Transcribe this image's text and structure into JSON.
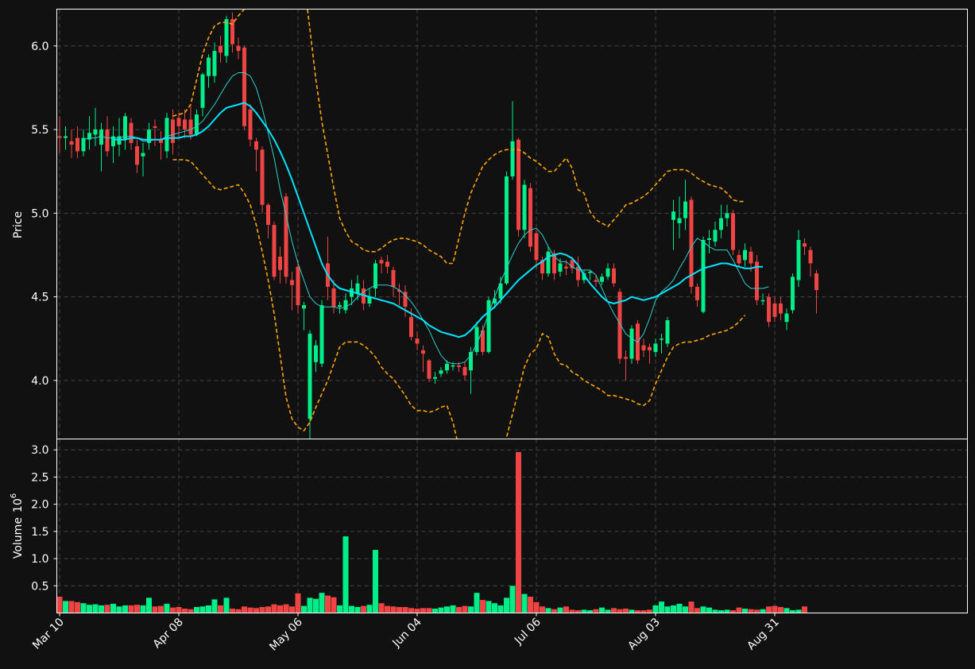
{
  "chart_data": {
    "type": "candlestick",
    "panels": [
      "price",
      "volume"
    ],
    "price_panel": {
      "ylabel": "Price",
      "ylim": [
        3.65,
        6.22
      ],
      "yticks": [
        4.0,
        4.5,
        5.0,
        5.5,
        6.0
      ],
      "ytick_labels": [
        "4.0",
        "4.5",
        "5.0",
        "5.5",
        "6.0"
      ]
    },
    "volume_panel": {
      "ylabel": "Volume",
      "ylabel_multiplier": "10",
      "ylabel_exponent": "6",
      "ylim": [
        0,
        3.2
      ],
      "yticks": [
        0.5,
        1.0,
        1.5,
        2.0,
        2.5,
        3.0
      ],
      "ytick_labels": [
        "0.5",
        "1.0",
        "1.5",
        "2.0",
        "2.5",
        "3.0"
      ]
    },
    "xtick_labels": [
      "Mar 10",
      "Apr 08",
      "May 06",
      "Jun 04",
      "Jul 06",
      "Aug 03",
      "Aug 31"
    ],
    "xtick_indices": [
      0,
      20,
      40,
      60,
      80,
      100,
      120
    ],
    "grid": true,
    "colors": {
      "background": "#111111",
      "up": "#00ee88",
      "down": "#ee4444",
      "ma_fast": "#30d0d0",
      "ma_slow": "#00e5ff",
      "bands": "#ffa500",
      "grid": "#444444",
      "text": "#ffffff"
    },
    "candles": [
      [
        5.46,
        5.45,
        5.58,
        5.36
      ],
      [
        5.45,
        5.46,
        5.52,
        5.38
      ],
      [
        5.43,
        5.41,
        5.5,
        5.33
      ],
      [
        5.45,
        5.37,
        5.52,
        5.33
      ],
      [
        5.37,
        5.45,
        5.5,
        5.34
      ],
      [
        5.44,
        5.48,
        5.58,
        5.38
      ],
      [
        5.47,
        5.5,
        5.63,
        5.4
      ],
      [
        5.41,
        5.5,
        5.54,
        5.25
      ],
      [
        5.5,
        5.37,
        5.58,
        5.34
      ],
      [
        5.4,
        5.46,
        5.52,
        5.3
      ],
      [
        5.41,
        5.46,
        5.57,
        5.34
      ],
      [
        5.44,
        5.58,
        5.6,
        5.38
      ],
      [
        5.54,
        5.42,
        5.57,
        5.38
      ],
      [
        5.4,
        5.29,
        5.44,
        5.24
      ],
      [
        5.34,
        5.36,
        5.42,
        5.22
      ],
      [
        5.42,
        5.5,
        5.54,
        5.38
      ],
      [
        5.52,
        5.51,
        5.56,
        5.4
      ],
      [
        5.44,
        5.42,
        5.49,
        5.32
      ],
      [
        5.37,
        5.57,
        5.6,
        5.33
      ],
      [
        5.56,
        5.42,
        5.62,
        5.35
      ],
      [
        5.57,
        5.52,
        5.6,
        5.45
      ],
      [
        5.56,
        5.5,
        5.62,
        5.45
      ],
      [
        5.56,
        5.47,
        5.64,
        5.44
      ],
      [
        5.47,
        5.59,
        5.62,
        5.46
      ],
      [
        5.63,
        5.83,
        5.84,
        5.58
      ],
      [
        5.82,
        5.93,
        5.95,
        5.75
      ],
      [
        5.82,
        5.97,
        6.02,
        5.78
      ],
      [
        6.0,
        5.96,
        6.06,
        5.9
      ],
      [
        5.94,
        6.16,
        6.18,
        5.9
      ],
      [
        6.16,
        6.01,
        6.2,
        5.96
      ],
      [
        6.0,
        5.97,
        6.05,
        5.92
      ],
      [
        5.99,
        5.52,
        6.0,
        5.5
      ],
      [
        5.62,
        5.44,
        5.65,
        5.4
      ],
      [
        5.43,
        5.38,
        5.45,
        5.25
      ],
      [
        5.38,
        5.05,
        5.4,
        5.0
      ],
      [
        5.05,
        4.93,
        5.06,
        4.85
      ],
      [
        4.93,
        4.62,
        4.95,
        4.6
      ],
      [
        4.74,
        4.66,
        4.8,
        4.58
      ],
      [
        5.1,
        4.62,
        5.12,
        4.58
      ],
      [
        4.6,
        4.57,
        4.65,
        4.42
      ],
      [
        4.68,
        4.45,
        4.72,
        4.4
      ],
      [
        4.43,
        4.45,
        4.47,
        4.3
      ],
      [
        3.77,
        4.28,
        4.3,
        3.62
      ],
      [
        4.11,
        4.21,
        4.24,
        4.05
      ],
      [
        4.1,
        4.45,
        4.48,
        4.08
      ],
      [
        4.7,
        4.56,
        4.86,
        4.48
      ],
      [
        4.55,
        4.44,
        4.6,
        4.4
      ],
      [
        4.44,
        4.45,
        4.47,
        4.4
      ],
      [
        4.42,
        4.48,
        4.52,
        4.4
      ],
      [
        4.5,
        4.55,
        4.6,
        4.45
      ],
      [
        4.52,
        4.58,
        4.63,
        4.48
      ],
      [
        4.55,
        4.46,
        4.6,
        4.42
      ],
      [
        4.46,
        4.5,
        4.55,
        4.44
      ],
      [
        4.55,
        4.7,
        4.72,
        4.5
      ],
      [
        4.72,
        4.7,
        4.74,
        4.64
      ],
      [
        4.71,
        4.68,
        4.75,
        4.64
      ],
      [
        4.66,
        4.56,
        4.68,
        4.5
      ],
      [
        4.54,
        4.53,
        4.58,
        4.45
      ],
      [
        4.53,
        4.44,
        4.57,
        4.38
      ],
      [
        4.38,
        4.26,
        4.43,
        4.24
      ],
      [
        4.25,
        4.22,
        4.29,
        4.18
      ],
      [
        4.18,
        4.16,
        4.21,
        4.05
      ],
      [
        4.12,
        4.01,
        4.13,
        3.99
      ],
      [
        4.01,
        4.02,
        4.05,
        3.98
      ],
      [
        4.04,
        4.06,
        4.08,
        4.02
      ],
      [
        4.06,
        4.1,
        4.12,
        4.04
      ],
      [
        4.09,
        4.09,
        4.11,
        4.06
      ],
      [
        4.09,
        4.08,
        4.11,
        4.05
      ],
      [
        4.08,
        4.03,
        4.11,
        4.0
      ],
      [
        4.06,
        4.17,
        4.2,
        3.92
      ],
      [
        4.17,
        4.32,
        4.35,
        4.15
      ],
      [
        4.3,
        4.17,
        4.33,
        4.15
      ],
      [
        4.17,
        4.48,
        4.5,
        4.16
      ],
      [
        4.46,
        4.49,
        4.54,
        4.43
      ],
      [
        4.49,
        4.58,
        4.62,
        4.46
      ],
      [
        4.58,
        5.22,
        5.25,
        4.57
      ],
      [
        5.22,
        5.43,
        5.67,
        5.2
      ],
      [
        5.44,
        4.9,
        5.45,
        4.86
      ],
      [
        4.9,
        5.17,
        5.2,
        4.85
      ],
      [
        5.15,
        4.8,
        5.18,
        4.77
      ],
      [
        4.88,
        4.72,
        4.9,
        4.67
      ],
      [
        4.72,
        4.64,
        4.74,
        4.6
      ],
      [
        4.64,
        4.77,
        4.8,
        4.62
      ],
      [
        4.76,
        4.64,
        4.78,
        4.6
      ],
      [
        4.65,
        4.7,
        4.73,
        4.62
      ],
      [
        4.68,
        4.67,
        4.72,
        4.63
      ],
      [
        4.72,
        4.67,
        4.74,
        4.64
      ],
      [
        4.68,
        4.6,
        4.74,
        4.56
      ],
      [
        4.6,
        4.64,
        4.66,
        4.58
      ],
      [
        4.65,
        4.65,
        4.66,
        4.6
      ],
      [
        4.6,
        4.59,
        4.63,
        4.56
      ],
      [
        4.59,
        4.62,
        4.64,
        4.57
      ],
      [
        4.62,
        4.67,
        4.7,
        4.6
      ],
      [
        4.67,
        4.58,
        4.7,
        4.56
      ],
      [
        4.53,
        4.13,
        4.55,
        4.1
      ],
      [
        4.14,
        4.13,
        4.18,
        4.0
      ],
      [
        4.13,
        4.31,
        4.33,
        4.1
      ],
      [
        4.34,
        4.12,
        4.36,
        4.1
      ],
      [
        4.21,
        4.18,
        4.25,
        4.14
      ],
      [
        4.2,
        4.18,
        4.22,
        4.1
      ],
      [
        4.17,
        4.22,
        4.25,
        4.14
      ],
      [
        4.25,
        4.25,
        4.28,
        4.16
      ],
      [
        4.22,
        4.36,
        4.38,
        4.2
      ],
      [
        4.96,
        5.01,
        5.08,
        4.78
      ],
      [
        4.94,
        4.97,
        5.1,
        4.85
      ],
      [
        4.97,
        5.07,
        5.2,
        4.9
      ],
      [
        5.08,
        4.56,
        5.1,
        4.52
      ],
      [
        4.56,
        4.48,
        4.58,
        4.44
      ],
      [
        4.41,
        4.84,
        4.86,
        4.4
      ],
      [
        4.84,
        4.85,
        4.9,
        4.76
      ],
      [
        4.83,
        4.9,
        4.95,
        4.8
      ],
      [
        4.9,
        4.97,
        5.05,
        4.85
      ],
      [
        4.97,
        5.0,
        5.05,
        4.92
      ],
      [
        5.0,
        4.78,
        5.02,
        4.75
      ],
      [
        4.75,
        4.7,
        4.78,
        4.68
      ],
      [
        4.72,
        4.78,
        4.82,
        4.68
      ],
      [
        4.77,
        4.7,
        4.8,
        4.65
      ],
      [
        4.71,
        4.48,
        4.75,
        4.45
      ],
      [
        4.48,
        4.48,
        4.52,
        4.45
      ],
      [
        4.5,
        4.35,
        4.52,
        4.32
      ],
      [
        4.46,
        4.38,
        4.5,
        4.35
      ],
      [
        4.46,
        4.4,
        4.5,
        4.36
      ],
      [
        4.35,
        4.4,
        4.43,
        4.3
      ],
      [
        4.42,
        4.62,
        4.64,
        4.4
      ],
      [
        4.6,
        4.84,
        4.9,
        4.56
      ],
      [
        4.82,
        4.8,
        4.85,
        4.75
      ],
      [
        4.78,
        4.7,
        4.8,
        4.62
      ],
      [
        4.64,
        4.54,
        4.66,
        4.4
      ]
    ],
    "ma_fast": [
      null,
      null,
      null,
      null,
      5.44,
      5.45,
      5.45,
      5.46,
      5.45,
      5.45,
      5.45,
      5.46,
      5.46,
      5.45,
      5.43,
      5.43,
      5.44,
      5.44,
      5.46,
      5.47,
      5.48,
      5.49,
      5.5,
      5.52,
      5.55,
      5.6,
      5.65,
      5.71,
      5.77,
      5.82,
      5.84,
      5.84,
      5.82,
      5.75,
      5.63,
      5.48,
      5.33,
      5.14,
      4.99,
      4.83,
      4.7,
      4.6,
      4.5,
      4.46,
      4.44,
      4.44,
      4.44,
      4.43,
      4.44,
      4.46,
      4.5,
      4.53,
      4.55,
      4.57,
      4.57,
      4.57,
      4.56,
      4.54,
      4.51,
      4.47,
      4.42,
      4.36,
      4.3,
      4.22,
      4.15,
      4.11,
      4.1,
      4.1,
      4.11,
      4.15,
      4.22,
      4.3,
      4.4,
      4.5,
      4.59,
      4.67,
      4.75,
      4.82,
      4.87,
      4.9,
      4.91,
      4.87,
      4.8,
      4.74,
      4.71,
      4.71,
      4.68,
      4.66,
      4.66,
      4.66,
      4.63,
      4.55,
      4.47,
      4.4,
      4.34,
      4.28,
      4.25,
      4.23,
      4.28,
      4.37,
      4.48,
      4.53,
      4.56,
      4.6,
      4.67,
      4.73,
      4.8,
      4.85,
      4.83,
      4.8,
      4.78,
      4.78,
      4.78,
      4.72,
      4.65,
      4.58,
      4.55,
      4.55,
      4.55,
      4.56
    ],
    "ma_slow": [
      null,
      null,
      null,
      null,
      null,
      null,
      null,
      null,
      null,
      5.44,
      5.44,
      5.44,
      5.45,
      5.45,
      5.44,
      5.44,
      5.44,
      5.44,
      5.45,
      5.45,
      5.45,
      5.46,
      5.46,
      5.47,
      5.49,
      5.52,
      5.56,
      5.6,
      5.63,
      5.64,
      5.65,
      5.66,
      5.64,
      5.6,
      5.55,
      5.5,
      5.44,
      5.37,
      5.29,
      5.2,
      5.1,
      5.0,
      4.9,
      4.8,
      4.7,
      4.63,
      4.58,
      4.55,
      4.54,
      4.53,
      4.52,
      4.51,
      4.5,
      4.49,
      4.48,
      4.47,
      4.46,
      4.44,
      4.42,
      4.4,
      4.38,
      4.36,
      4.33,
      4.31,
      4.29,
      4.28,
      4.27,
      4.26,
      4.27,
      4.3,
      4.34,
      4.38,
      4.41,
      4.44,
      4.48,
      4.52,
      4.56,
      4.6,
      4.63,
      4.66,
      4.69,
      4.71,
      4.74,
      4.75,
      4.76,
      4.75,
      4.73,
      4.69,
      4.63,
      4.58,
      4.54,
      4.5,
      4.47,
      4.46,
      4.47,
      4.48,
      4.5,
      4.49,
      4.48,
      4.49,
      4.5,
      4.52,
      4.54,
      4.56,
      4.58,
      4.61,
      4.63,
      4.65,
      4.67,
      4.68,
      4.69,
      4.7,
      4.7,
      4.69,
      4.68,
      4.67,
      4.67,
      4.68,
      4.68
    ],
    "band_upper": [
      null,
      null,
      null,
      null,
      null,
      null,
      null,
      null,
      null,
      null,
      null,
      null,
      null,
      null,
      null,
      null,
      null,
      null,
      null,
      5.58,
      5.59,
      5.6,
      5.65,
      5.8,
      5.95,
      6.05,
      6.12,
      6.14,
      6.14,
      6.13,
      6.18,
      6.22,
      6.4,
      6.6,
      6.8,
      7.0,
      7.2,
      7.2,
      7.1,
      7.0,
      6.8,
      6.4,
      6.1,
      5.8,
      5.55,
      5.35,
      5.15,
      4.97,
      4.89,
      4.83,
      4.81,
      4.78,
      4.77,
      4.77,
      4.79,
      4.82,
      4.84,
      4.85,
      4.85,
      4.84,
      4.83,
      4.81,
      4.78,
      4.76,
      4.74,
      4.7,
      4.7,
      4.85,
      5.0,
      5.12,
      5.2,
      5.28,
      5.32,
      5.35,
      5.37,
      5.38,
      5.38,
      5.38,
      5.36,
      5.33,
      5.31,
      5.28,
      5.25,
      5.25,
      5.29,
      5.33,
      5.27,
      5.14,
      5.12,
      5.01,
      4.96,
      4.94,
      4.92,
      4.96,
      5.0,
      5.05,
      5.06,
      5.08,
      5.1,
      5.13,
      5.17,
      5.21,
      5.25,
      5.26,
      5.26,
      5.26,
      5.24,
      5.21,
      5.19,
      5.17,
      5.16,
      5.15,
      5.12,
      5.08,
      5.07,
      5.07
    ],
    "band_lower": [
      null,
      null,
      null,
      null,
      null,
      null,
      null,
      null,
      null,
      null,
      null,
      null,
      null,
      null,
      null,
      null,
      null,
      null,
      null,
      5.32,
      5.32,
      5.32,
      5.31,
      5.27,
      5.23,
      5.19,
      5.15,
      5.14,
      5.15,
      5.16,
      5.17,
      5.12,
      5.05,
      4.93,
      4.77,
      4.6,
      4.4,
      4.15,
      3.9,
      3.77,
      3.72,
      3.7,
      3.75,
      3.84,
      3.92,
      4.0,
      4.1,
      4.2,
      4.23,
      4.23,
      4.23,
      4.21,
      4.18,
      4.14,
      4.08,
      4.04,
      4.01,
      3.96,
      3.91,
      3.85,
      3.82,
      3.82,
      3.81,
      3.82,
      3.84,
      3.85,
      3.75,
      3.6,
      3.4,
      3.25,
      3.1,
      3.0,
      3.1,
      3.3,
      3.49,
      3.66,
      3.8,
      3.94,
      4.08,
      4.16,
      4.19,
      4.28,
      4.26,
      4.16,
      4.1,
      4.09,
      4.05,
      4.03,
      4.0,
      3.98,
      3.96,
      3.94,
      3.91,
      3.91,
      3.9,
      3.89,
      3.88,
      3.86,
      3.85,
      3.88,
      3.98,
      4.06,
      4.14,
      4.2,
      4.22,
      4.23,
      4.23,
      4.24,
      4.25,
      4.27,
      4.28,
      4.29,
      4.3,
      4.32,
      4.35,
      4.39
    ],
    "volume": [
      0.3,
      0.22,
      0.22,
      0.2,
      0.18,
      0.15,
      0.16,
      0.14,
      0.15,
      0.17,
      0.12,
      0.14,
      0.14,
      0.15,
      0.14,
      0.28,
      0.12,
      0.13,
      0.17,
      0.1,
      0.11,
      0.08,
      0.07,
      0.11,
      0.12,
      0.14,
      0.25,
      0.14,
      0.28,
      0.08,
      0.07,
      0.12,
      0.1,
      0.09,
      0.11,
      0.12,
      0.16,
      0.14,
      0.16,
      0.12,
      0.36,
      0.13,
      0.28,
      0.26,
      0.37,
      0.32,
      0.29,
      0.14,
      1.41,
      0.13,
      0.11,
      0.13,
      0.15,
      1.16,
      0.18,
      0.13,
      0.12,
      0.11,
      0.11,
      0.09,
      0.08,
      0.09,
      0.09,
      0.08,
      0.1,
      0.12,
      0.14,
      0.11,
      0.13,
      0.12,
      0.37,
      0.24,
      0.22,
      0.18,
      0.14,
      0.28,
      0.5,
      2.96,
      0.35,
      0.3,
      0.2,
      0.12,
      0.09,
      0.07,
      0.1,
      0.12,
      0.06,
      0.05,
      0.06,
      0.05,
      0.07,
      0.1,
      0.06,
      0.09,
      0.07,
      0.08,
      0.06,
      0.05,
      0.05,
      0.06,
      0.14,
      0.21,
      0.12,
      0.14,
      0.17,
      0.12,
      0.21,
      0.09,
      0.12,
      0.1,
      0.06,
      0.05,
      0.06,
      0.05,
      0.1,
      0.08,
      0.07,
      0.06,
      0.07,
      0.12,
      0.13,
      0.11,
      0.09,
      0.05,
      0.06,
      0.12
    ]
  }
}
